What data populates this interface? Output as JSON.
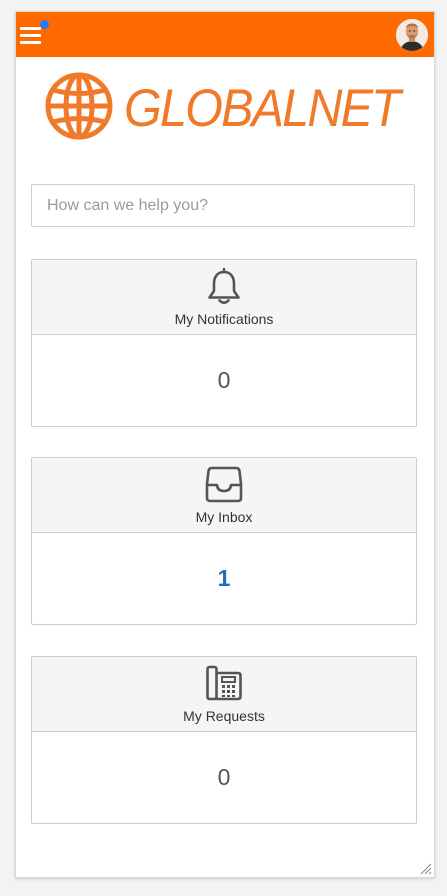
{
  "header": {
    "menu_icon": "hamburger-menu-icon",
    "notification_dot_color": "#2979ff",
    "bar_color": "#ff6a00",
    "avatar": "user-avatar"
  },
  "brand": {
    "logo_text": "GLOBALNET",
    "logo_icon": "globe-icon",
    "color": "#f07a2a"
  },
  "search": {
    "placeholder": "How can we help you?",
    "value": ""
  },
  "cards": [
    {
      "icon": "bell-icon",
      "title": "My Notifications",
      "count": "0"
    },
    {
      "icon": "inbox-icon",
      "title": "My Inbox",
      "count": "1"
    },
    {
      "icon": "phone-icon",
      "title": "My Requests",
      "count": "0"
    }
  ]
}
